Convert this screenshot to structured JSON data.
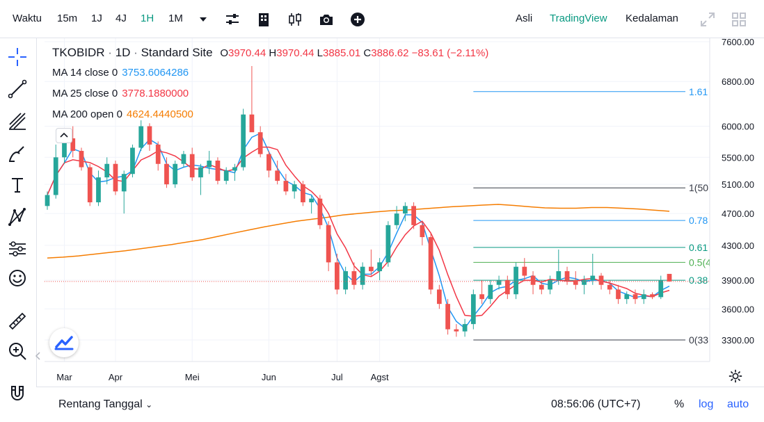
{
  "toolbar": {
    "interval_label": "Waktu",
    "intervals": [
      "15m",
      "1J",
      "4J",
      "1H",
      "1M"
    ],
    "active_interval": "1H",
    "right": {
      "asli": "Asli",
      "tradingview": "TradingView",
      "kedalaman": "Kedalaman"
    }
  },
  "legend": {
    "symbol": "TKOBIDR",
    "timeframe": "1D",
    "exchange": "Standard Site",
    "o_label": "O",
    "o": "3970.44",
    "h_label": "H",
    "h": "3970.44",
    "l_label": "L",
    "l": "3885.01",
    "c_label": "C",
    "c": "3886.62",
    "change": "−83.61 (−2.11%)",
    "ma14_label": "MA 14 close 0",
    "ma14": "3753.6064286",
    "ma25_label": "MA 25 close 0",
    "ma25": "3778.1880000",
    "ma200_label": "MA 200 open 0",
    "ma200": "4624.4440500"
  },
  "bottom": {
    "range": "Rentang Tanggal",
    "time": "08:56:06 (UTC+7)",
    "percent": "%",
    "log": "log",
    "auto": "auto"
  },
  "colors": {
    "up": "#26a69a",
    "down": "#ef5350",
    "ma14": "#2196f3",
    "ma25": "#f23645",
    "ma200": "#f57c00",
    "accent": "#2962ff"
  },
  "chart_data": {
    "type": "candlestick",
    "scale": "log",
    "yticks": [
      "7600.00",
      "6800.00",
      "6000.00",
      "5500.00",
      "5100.00",
      "4700.00",
      "4300.00",
      "3900.00",
      "3600.00",
      "3300.00"
    ],
    "xticks": [
      "Mar",
      "Apr",
      "Mei",
      "Jun",
      "Jul",
      "Agst"
    ],
    "last_price": "3886.62",
    "fib_labels": [
      "1.61",
      "1(50",
      "0.78",
      "0.61",
      "0.5(4",
      "0.38",
      "0(33"
    ],
    "fib_levels": [
      6610,
      5050,
      4610,
      4275,
      4100,
      3900,
      3300
    ],
    "fib_colors": [
      "#2196f3",
      "#363a45",
      "#2196f3",
      "#089981",
      "#4caf50",
      "#089981",
      "#363a45"
    ],
    "ma200": [
      4150,
      4160,
      4175,
      4195,
      4215,
      4235,
      4260,
      4285,
      4310,
      4340,
      4370,
      4410,
      4450,
      4490,
      4530,
      4565,
      4600,
      4625,
      4650,
      4680,
      4700,
      4720,
      4735,
      4745,
      4760,
      4775,
      4790,
      4800,
      4812,
      4822,
      4808,
      4790,
      4775,
      4770,
      4770,
      4780,
      4780,
      4770,
      4760,
      4745,
      4730
    ],
    "ohlc": [
      [
        4800,
        5000,
        4750,
        4950
      ],
      [
        4950,
        5700,
        4900,
        5500
      ],
      [
        5500,
        5900,
        5400,
        5800
      ],
      [
        5800,
        6000,
        5500,
        5600
      ],
      [
        5600,
        5650,
        5300,
        5350
      ],
      [
        5350,
        5400,
        4800,
        4850
      ],
      [
        4850,
        5300,
        4800,
        5200
      ],
      [
        5200,
        5500,
        5100,
        5400
      ],
      [
        5400,
        5450,
        4950,
        5000
      ],
      [
        5000,
        5300,
        4700,
        5250
      ],
      [
        5250,
        5700,
        5200,
        5650
      ],
      [
        5650,
        6100,
        5600,
        6000
      ],
      [
        6000,
        6050,
        5600,
        5700
      ],
      [
        5700,
        5750,
        5300,
        5400
      ],
      [
        5400,
        5500,
        5050,
        5100
      ],
      [
        5100,
        5450,
        5050,
        5400
      ],
      [
        5400,
        5600,
        5350,
        5550
      ],
      [
        5550,
        5650,
        5150,
        5200
      ],
      [
        5200,
        5400,
        4950,
        5350
      ],
      [
        5350,
        5600,
        5250,
        5450
      ],
      [
        5450,
        5500,
        5100,
        5150
      ],
      [
        5150,
        5350,
        5100,
        5300
      ],
      [
        5300,
        5400,
        5150,
        5350
      ],
      [
        5350,
        6300,
        5300,
        6200
      ],
      [
        6200,
        7100,
        6100,
        5900
      ],
      [
        5900,
        6000,
        5500,
        5550
      ],
      [
        5550,
        5600,
        5200,
        5300
      ],
      [
        5300,
        5450,
        5100,
        5150
      ],
      [
        5150,
        5250,
        4950,
        5000
      ],
      [
        5000,
        5150,
        4900,
        5100
      ],
      [
        5100,
        5150,
        4800,
        4850
      ],
      [
        4850,
        4950,
        4700,
        4900
      ],
      [
        4900,
        4950,
        4500,
        4550
      ],
      [
        4550,
        4600,
        4000,
        4100
      ],
      [
        4100,
        4200,
        3750,
        3800
      ],
      [
        3800,
        4050,
        3750,
        4000
      ],
      [
        4000,
        4100,
        3800,
        3850
      ],
      [
        3850,
        4100,
        3800,
        4050
      ],
      [
        4050,
        4250,
        3950,
        4000
      ],
      [
        4000,
        4150,
        3900,
        4100
      ],
      [
        4100,
        4600,
        4050,
        4550
      ],
      [
        4550,
        4800,
        4500,
        4700
      ],
      [
        4700,
        4850,
        4600,
        4800
      ],
      [
        4800,
        4850,
        4500,
        4550
      ],
      [
        4550,
        4600,
        4300,
        4400
      ],
      [
        4400,
        4450,
        3750,
        3800
      ],
      [
        3800,
        3850,
        3600,
        3650
      ],
      [
        3650,
        3700,
        3350,
        3400
      ],
      [
        3400,
        3450,
        3330,
        3380
      ],
      [
        3380,
        3500,
        3330,
        3450
      ],
      [
        3450,
        3800,
        3400,
        3750
      ],
      [
        3750,
        3900,
        3650,
        3700
      ],
      [
        3700,
        3900,
        3650,
        3850
      ],
      [
        3850,
        3950,
        3800,
        3900
      ],
      [
        3900,
        3950,
        3700,
        3750
      ],
      [
        3750,
        4100,
        3700,
        4050
      ],
      [
        4050,
        4150,
        3900,
        3950
      ],
      [
        3950,
        4000,
        3750,
        3850
      ],
      [
        3850,
        3900,
        3750,
        3800
      ],
      [
        3800,
        3950,
        3750,
        3900
      ],
      [
        3900,
        4250,
        3850,
        4000
      ],
      [
        4000,
        4050,
        3850,
        3900
      ],
      [
        3900,
        4000,
        3800,
        3850
      ],
      [
        3850,
        3950,
        3750,
        3900
      ],
      [
        3900,
        4200,
        3850,
        3950
      ],
      [
        3950,
        3980,
        3800,
        3850
      ],
      [
        3850,
        3900,
        3750,
        3800
      ],
      [
        3800,
        3850,
        3650,
        3700
      ],
      [
        3700,
        3780,
        3650,
        3750
      ],
      [
        3750,
        3800,
        3650,
        3700
      ],
      [
        3700,
        3800,
        3650,
        3750
      ],
      [
        3750,
        3770,
        3700,
        3720
      ],
      [
        3720,
        3950,
        3700,
        3900
      ],
      [
        3970,
        3970,
        3885,
        3887
      ]
    ]
  }
}
